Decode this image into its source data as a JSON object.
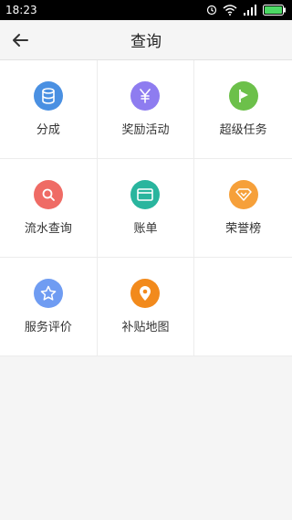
{
  "status_bar": {
    "time": "18:23"
  },
  "header": {
    "title": "查询"
  },
  "items": [
    {
      "label": "分成",
      "color": "#4a90e2",
      "icon": "database-icon"
    },
    {
      "label": "奖励活动",
      "color": "#8e7cf0",
      "icon": "yen-icon"
    },
    {
      "label": "超级任务",
      "color": "#6cc04a",
      "icon": "flag-icon"
    },
    {
      "label": "流水查询",
      "color": "#ef6b65",
      "icon": "search-icon"
    },
    {
      "label": "账单",
      "color": "#29b59e",
      "icon": "card-icon"
    },
    {
      "label": "荣誉榜",
      "color": "#f6a03a",
      "icon": "diamond-icon"
    },
    {
      "label": "服务评价",
      "color": "#6f9cf2",
      "icon": "star-icon"
    },
    {
      "label": "补贴地图",
      "color": "#f28a1c",
      "icon": "location-pin-icon"
    }
  ]
}
